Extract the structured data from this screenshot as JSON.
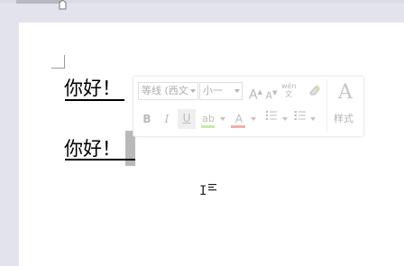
{
  "document": {
    "paragraph1": "你好！",
    "paragraph2": "你好！"
  },
  "mini_toolbar": {
    "font_name": "等线 (西文",
    "font_size": "小一",
    "grow_label": "A",
    "shrink_label": "A",
    "pinyin_label": "wén 文",
    "bold_label": "B",
    "italic_label": "I",
    "underline_label": "U",
    "highlight_label": "ab",
    "font_color_label": "A",
    "styles_icon_label": "A",
    "styles_label": "样式",
    "colors": {
      "highlight": "#c6e9a6",
      "font_color": "#f2aaa6"
    }
  },
  "cursor": {
    "glyph": "I"
  }
}
